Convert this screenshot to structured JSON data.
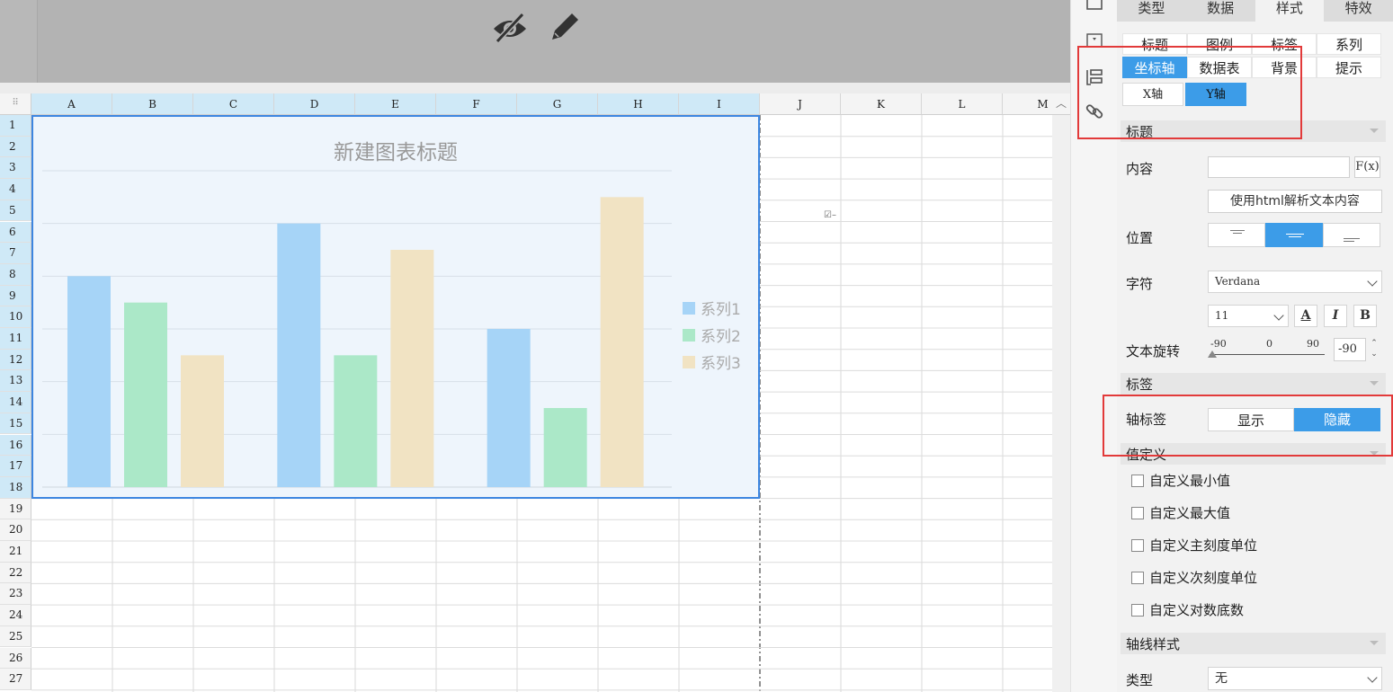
{
  "toolbar": {
    "hide_icon": "eye-slash-icon",
    "edit_icon": "pencil-icon"
  },
  "sheet": {
    "columns": [
      "A",
      "B",
      "C",
      "D",
      "E",
      "F",
      "G",
      "H",
      "I",
      "J",
      "K",
      "L",
      "M"
    ],
    "selected_columns": 9,
    "rows": [
      "1",
      "2",
      "3",
      "4",
      "5",
      "6",
      "7",
      "8",
      "9",
      "10",
      "11",
      "12",
      "13",
      "14",
      "15",
      "16",
      "17",
      "18",
      "19",
      "20",
      "21",
      "22",
      "23",
      "24",
      "25",
      "26",
      "27"
    ],
    "selected_rows": 18
  },
  "chart_data": {
    "type": "bar",
    "title": "新建图表标题",
    "categories": [
      "",
      "",
      ""
    ],
    "series": [
      {
        "name": "系列1",
        "color": "#a6d4f7",
        "values": [
          8,
          10,
          6
        ]
      },
      {
        "name": "系列2",
        "color": "#abe8c8",
        "values": [
          7,
          5,
          3
        ]
      },
      {
        "name": "系列3",
        "color": "#f1e3c3",
        "values": [
          5,
          9,
          11
        ]
      }
    ],
    "ylim": [
      0,
      12
    ],
    "grid": true,
    "legend": "right",
    "axis_labels_shown": false
  },
  "panel": {
    "main_tabs": [
      "类型",
      "数据",
      "样式",
      "特效"
    ],
    "active_main_tab": 2,
    "sub_tabs_row1": [
      "标题",
      "图例",
      "标签",
      "系列"
    ],
    "sub_tabs_row2": [
      "坐标轴",
      "数据表",
      "背景",
      "提示"
    ],
    "axis_tabs": [
      "X轴",
      "Y轴"
    ],
    "title_section": "标题",
    "content_label": "内容",
    "content_value": "",
    "formula_button": "F(x)",
    "html_parse_button": "使用html解析文本内容",
    "position_label": "位置",
    "font_label": "字符",
    "font_family": "Verdana",
    "font_size": "11",
    "format_buttons": [
      "A",
      "I",
      "B"
    ],
    "rotation_label": "文本旋转",
    "rotation_ticks": [
      "-90",
      "0",
      "90"
    ],
    "rotation_value": "-90",
    "label_section": "标签",
    "axis_label_label": "轴标签",
    "show_label": "显示",
    "hide_label": "隐藏",
    "value_section": "值定义",
    "checkboxes": [
      "自定义最小值",
      "自定义最大值",
      "自定义主刻度单位",
      "自定义次刻度单位",
      "自定义对数底数"
    ],
    "line_section": "轴线样式",
    "type_label": "类型",
    "type_value": "无"
  },
  "colors": {
    "accent": "#3c9ce8",
    "chart_border": "#3d86e0",
    "highlight": "#e23a3a"
  }
}
